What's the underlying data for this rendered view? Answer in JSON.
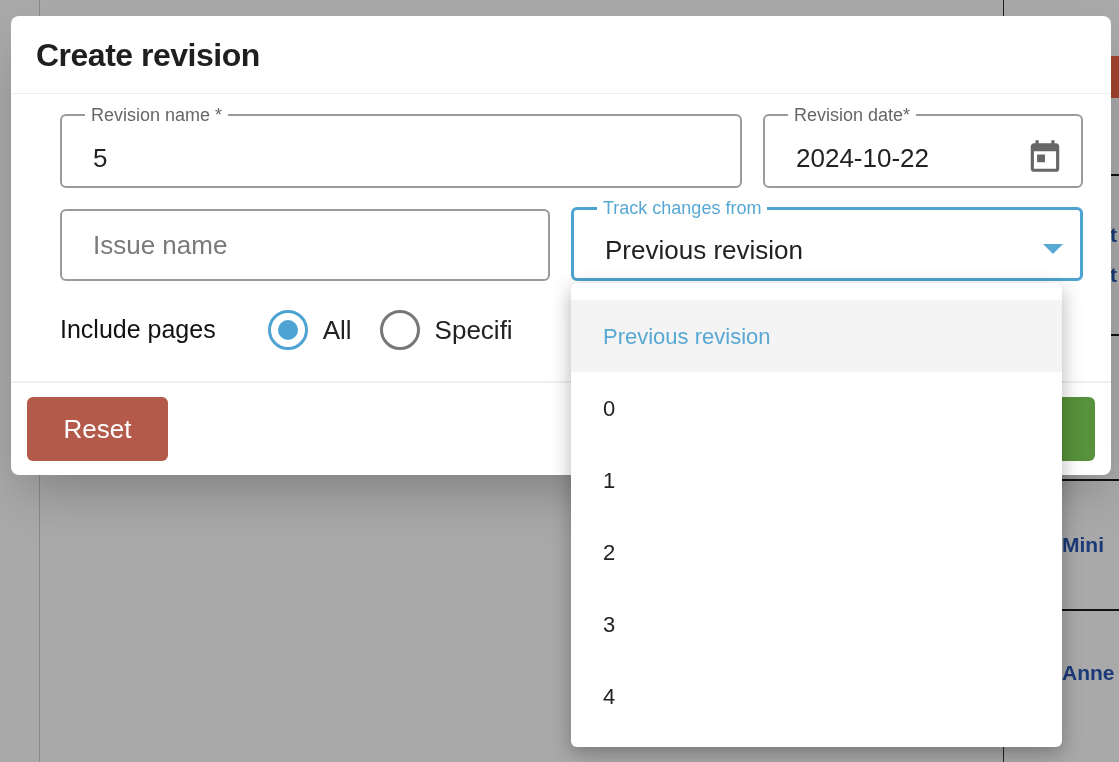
{
  "background": {
    "rows": [
      {
        "lines": []
      },
      {
        "lines": [
          "t",
          "t"
        ]
      },
      {
        "lines": []
      },
      {
        "lines": [
          "Mini"
        ]
      },
      {
        "lines": [
          "Anne"
        ]
      }
    ]
  },
  "dialog": {
    "title": "Create revision",
    "fields": [
      {
        "kind": "text",
        "label": "Revision name *",
        "value": "5",
        "focused": false
      },
      {
        "kind": "date",
        "label": "Revision date*",
        "value": "2024-10-22",
        "focused": false
      },
      {
        "kind": "text",
        "placeholder": "Issue name",
        "focused": false
      },
      {
        "kind": "select",
        "label": "Track changes from",
        "value": "Previous revision",
        "focused": true
      }
    ],
    "include_pages": {
      "label": "Include pages",
      "options": [
        {
          "label": "All",
          "selected": true
        },
        {
          "label": "Specifi",
          "selected": false
        }
      ]
    },
    "buttons": [
      {
        "kind": "reset",
        "label": "Reset"
      },
      {
        "kind": "confirm"
      }
    ]
  },
  "dropdown": {
    "options": [
      {
        "label": "Previous revision",
        "selected": true
      },
      {
        "label": "0",
        "selected": false
      },
      {
        "label": "1",
        "selected": false
      },
      {
        "label": "2",
        "selected": false
      },
      {
        "label": "3",
        "selected": false
      },
      {
        "label": "4",
        "selected": false
      }
    ]
  }
}
